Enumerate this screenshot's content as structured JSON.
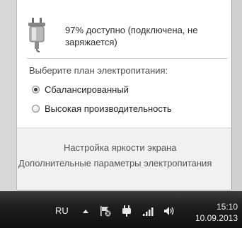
{
  "battery": {
    "status_line1": "97% доступно (подключена, не",
    "status_line2": "заряжается)"
  },
  "power_plan": {
    "heading": "Выберите план электропитания:",
    "options": [
      {
        "label": "Сбалансированный",
        "selected": true
      },
      {
        "label": "Высокая производительность",
        "selected": false
      }
    ]
  },
  "links": {
    "brightness": "Настройка яркости экрана",
    "more_options": "Дополнительные параметры электропитания"
  },
  "taskbar": {
    "language": "RU",
    "time": "15:10",
    "date": "10.09.2013",
    "icons": [
      "show-hidden-icons",
      "action-center-flag-icon",
      "power-plug-icon",
      "network-signal-icon",
      "speaker-volume-icon"
    ]
  }
}
